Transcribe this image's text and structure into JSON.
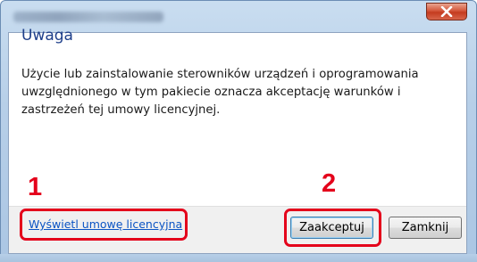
{
  "dialog": {
    "heading": "Uwaga",
    "message": "Użycie lub zainstalowanie sterowników urządzeń i oprogramowania uwzględnionego w tym pakiecie oznacza akceptację warunków i zastrzeżeń tej umowy licencyjnej.",
    "license_link": "Wyświetl umowę licencyjna",
    "accept_label": "Zaakceptuj",
    "close_label": "Zamknij"
  },
  "annotations": {
    "step_1": "1",
    "step_2": "2",
    "highlight_color": "#e4021b"
  },
  "icons": {
    "close": "close-icon"
  }
}
